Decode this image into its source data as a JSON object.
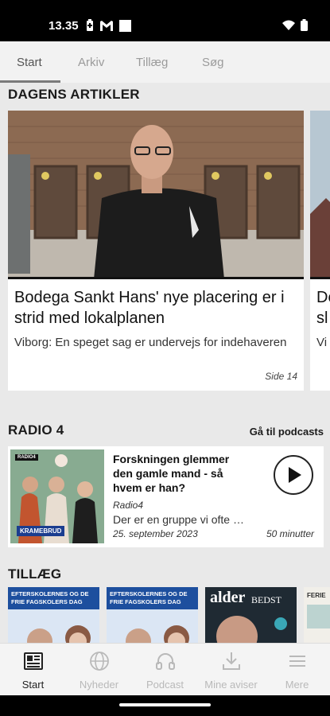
{
  "status_bar": {
    "time": "13.35",
    "icons": [
      "battery-saver-icon",
      "gmail-icon",
      "square-notification-icon",
      "wifi-icon",
      "battery-icon"
    ]
  },
  "tabs": [
    {
      "label": "Start",
      "active": true
    },
    {
      "label": "Arkiv",
      "active": false
    },
    {
      "label": "Tillæg",
      "active": false
    },
    {
      "label": "Søg",
      "active": false
    }
  ],
  "articles": {
    "section_title": "DAGENS ARTIKLER",
    "items": [
      {
        "headline": "Bodega Sankt Hans' nye placering er i strid med lokalplanen",
        "lead": "Viborg: En speget sag er undervejs for indehaveren",
        "page": "Side 14"
      },
      {
        "headline": "De sl",
        "lead": "Vi",
        "page": ""
      }
    ]
  },
  "radio": {
    "section_title": "RADIO 4",
    "link_label": "Gå til podcasts",
    "episode": {
      "thumbnail_badge": "RADIO4",
      "thumbnail_caption": "KRAMEBRUD",
      "title": "Forskningen glemmer den gamle mand - så hvem er han?",
      "source": "Radio4",
      "description": "Der er en gruppe vi ofte glemmer",
      "date": "25. september 2023",
      "duration": "50 minutter"
    }
  },
  "supplements": {
    "section_title": "TILLÆG",
    "items": [
      {
        "cover_text": "EFTERSKOLERNES OG DE FRIE FAGSKOLERS DAG"
      },
      {
        "cover_text": "EFTERSKOLERNES OG DE FRIE FAGSKOLERS DAG"
      },
      {
        "cover_text_a": "alder",
        "cover_text_b": "BEDST"
      },
      {
        "cover_text": "FERIE"
      }
    ]
  },
  "bottom_nav": [
    {
      "label": "Start",
      "icon": "newspaper-icon",
      "active": true
    },
    {
      "label": "Nyheder",
      "icon": "globe-icon",
      "active": false
    },
    {
      "label": "Podcast",
      "icon": "headphones-icon",
      "active": false
    },
    {
      "label": "Mine aviser",
      "icon": "download-icon",
      "active": false
    },
    {
      "label": "Mere",
      "icon": "menu-icon",
      "active": false
    }
  ],
  "colors": {
    "app_background": "#e9e9e9",
    "card_background": "#ffffff",
    "active_text": "#222222",
    "inactive_text": "#b9b9b9"
  }
}
